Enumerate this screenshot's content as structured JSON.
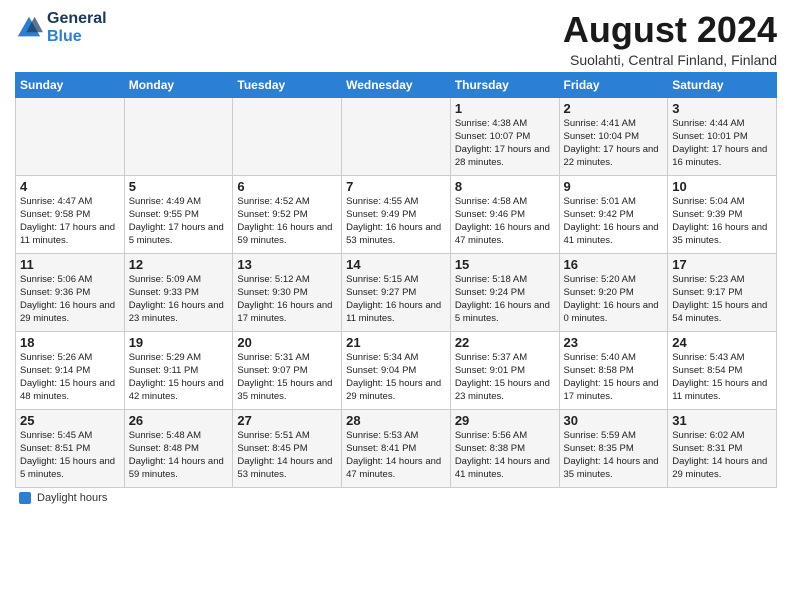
{
  "logo": {
    "line1": "General",
    "line2": "Blue"
  },
  "title": "August 2024",
  "subtitle": "Suolahti, Central Finland, Finland",
  "columns": [
    "Sunday",
    "Monday",
    "Tuesday",
    "Wednesday",
    "Thursday",
    "Friday",
    "Saturday"
  ],
  "weeks": [
    [
      {
        "num": "",
        "sunrise": "",
        "sunset": "",
        "daylight": ""
      },
      {
        "num": "",
        "sunrise": "",
        "sunset": "",
        "daylight": ""
      },
      {
        "num": "",
        "sunrise": "",
        "sunset": "",
        "daylight": ""
      },
      {
        "num": "",
        "sunrise": "",
        "sunset": "",
        "daylight": ""
      },
      {
        "num": "1",
        "sunrise": "Sunrise: 4:38 AM",
        "sunset": "Sunset: 10:07 PM",
        "daylight": "Daylight: 17 hours and 28 minutes."
      },
      {
        "num": "2",
        "sunrise": "Sunrise: 4:41 AM",
        "sunset": "Sunset: 10:04 PM",
        "daylight": "Daylight: 17 hours and 22 minutes."
      },
      {
        "num": "3",
        "sunrise": "Sunrise: 4:44 AM",
        "sunset": "Sunset: 10:01 PM",
        "daylight": "Daylight: 17 hours and 16 minutes."
      }
    ],
    [
      {
        "num": "4",
        "sunrise": "Sunrise: 4:47 AM",
        "sunset": "Sunset: 9:58 PM",
        "daylight": "Daylight: 17 hours and 11 minutes."
      },
      {
        "num": "5",
        "sunrise": "Sunrise: 4:49 AM",
        "sunset": "Sunset: 9:55 PM",
        "daylight": "Daylight: 17 hours and 5 minutes."
      },
      {
        "num": "6",
        "sunrise": "Sunrise: 4:52 AM",
        "sunset": "Sunset: 9:52 PM",
        "daylight": "Daylight: 16 hours and 59 minutes."
      },
      {
        "num": "7",
        "sunrise": "Sunrise: 4:55 AM",
        "sunset": "Sunset: 9:49 PM",
        "daylight": "Daylight: 16 hours and 53 minutes."
      },
      {
        "num": "8",
        "sunrise": "Sunrise: 4:58 AM",
        "sunset": "Sunset: 9:46 PM",
        "daylight": "Daylight: 16 hours and 47 minutes."
      },
      {
        "num": "9",
        "sunrise": "Sunrise: 5:01 AM",
        "sunset": "Sunset: 9:42 PM",
        "daylight": "Daylight: 16 hours and 41 minutes."
      },
      {
        "num": "10",
        "sunrise": "Sunrise: 5:04 AM",
        "sunset": "Sunset: 9:39 PM",
        "daylight": "Daylight: 16 hours and 35 minutes."
      }
    ],
    [
      {
        "num": "11",
        "sunrise": "Sunrise: 5:06 AM",
        "sunset": "Sunset: 9:36 PM",
        "daylight": "Daylight: 16 hours and 29 minutes."
      },
      {
        "num": "12",
        "sunrise": "Sunrise: 5:09 AM",
        "sunset": "Sunset: 9:33 PM",
        "daylight": "Daylight: 16 hours and 23 minutes."
      },
      {
        "num": "13",
        "sunrise": "Sunrise: 5:12 AM",
        "sunset": "Sunset: 9:30 PM",
        "daylight": "Daylight: 16 hours and 17 minutes."
      },
      {
        "num": "14",
        "sunrise": "Sunrise: 5:15 AM",
        "sunset": "Sunset: 9:27 PM",
        "daylight": "Daylight: 16 hours and 11 minutes."
      },
      {
        "num": "15",
        "sunrise": "Sunrise: 5:18 AM",
        "sunset": "Sunset: 9:24 PM",
        "daylight": "Daylight: 16 hours and 5 minutes."
      },
      {
        "num": "16",
        "sunrise": "Sunrise: 5:20 AM",
        "sunset": "Sunset: 9:20 PM",
        "daylight": "Daylight: 16 hours and 0 minutes."
      },
      {
        "num": "17",
        "sunrise": "Sunrise: 5:23 AM",
        "sunset": "Sunset: 9:17 PM",
        "daylight": "Daylight: 15 hours and 54 minutes."
      }
    ],
    [
      {
        "num": "18",
        "sunrise": "Sunrise: 5:26 AM",
        "sunset": "Sunset: 9:14 PM",
        "daylight": "Daylight: 15 hours and 48 minutes."
      },
      {
        "num": "19",
        "sunrise": "Sunrise: 5:29 AM",
        "sunset": "Sunset: 9:11 PM",
        "daylight": "Daylight: 15 hours and 42 minutes."
      },
      {
        "num": "20",
        "sunrise": "Sunrise: 5:31 AM",
        "sunset": "Sunset: 9:07 PM",
        "daylight": "Daylight: 15 hours and 35 minutes."
      },
      {
        "num": "21",
        "sunrise": "Sunrise: 5:34 AM",
        "sunset": "Sunset: 9:04 PM",
        "daylight": "Daylight: 15 hours and 29 minutes."
      },
      {
        "num": "22",
        "sunrise": "Sunrise: 5:37 AM",
        "sunset": "Sunset: 9:01 PM",
        "daylight": "Daylight: 15 hours and 23 minutes."
      },
      {
        "num": "23",
        "sunrise": "Sunrise: 5:40 AM",
        "sunset": "Sunset: 8:58 PM",
        "daylight": "Daylight: 15 hours and 17 minutes."
      },
      {
        "num": "24",
        "sunrise": "Sunrise: 5:43 AM",
        "sunset": "Sunset: 8:54 PM",
        "daylight": "Daylight: 15 hours and 11 minutes."
      }
    ],
    [
      {
        "num": "25",
        "sunrise": "Sunrise: 5:45 AM",
        "sunset": "Sunset: 8:51 PM",
        "daylight": "Daylight: 15 hours and 5 minutes."
      },
      {
        "num": "26",
        "sunrise": "Sunrise: 5:48 AM",
        "sunset": "Sunset: 8:48 PM",
        "daylight": "Daylight: 14 hours and 59 minutes."
      },
      {
        "num": "27",
        "sunrise": "Sunrise: 5:51 AM",
        "sunset": "Sunset: 8:45 PM",
        "daylight": "Daylight: 14 hours and 53 minutes."
      },
      {
        "num": "28",
        "sunrise": "Sunrise: 5:53 AM",
        "sunset": "Sunset: 8:41 PM",
        "daylight": "Daylight: 14 hours and 47 minutes."
      },
      {
        "num": "29",
        "sunrise": "Sunrise: 5:56 AM",
        "sunset": "Sunset: 8:38 PM",
        "daylight": "Daylight: 14 hours and 41 minutes."
      },
      {
        "num": "30",
        "sunrise": "Sunrise: 5:59 AM",
        "sunset": "Sunset: 8:35 PM",
        "daylight": "Daylight: 14 hours and 35 minutes."
      },
      {
        "num": "31",
        "sunrise": "Sunrise: 6:02 AM",
        "sunset": "Sunset: 8:31 PM",
        "daylight": "Daylight: 14 hours and 29 minutes."
      }
    ]
  ],
  "footer_label": "Daylight hours"
}
